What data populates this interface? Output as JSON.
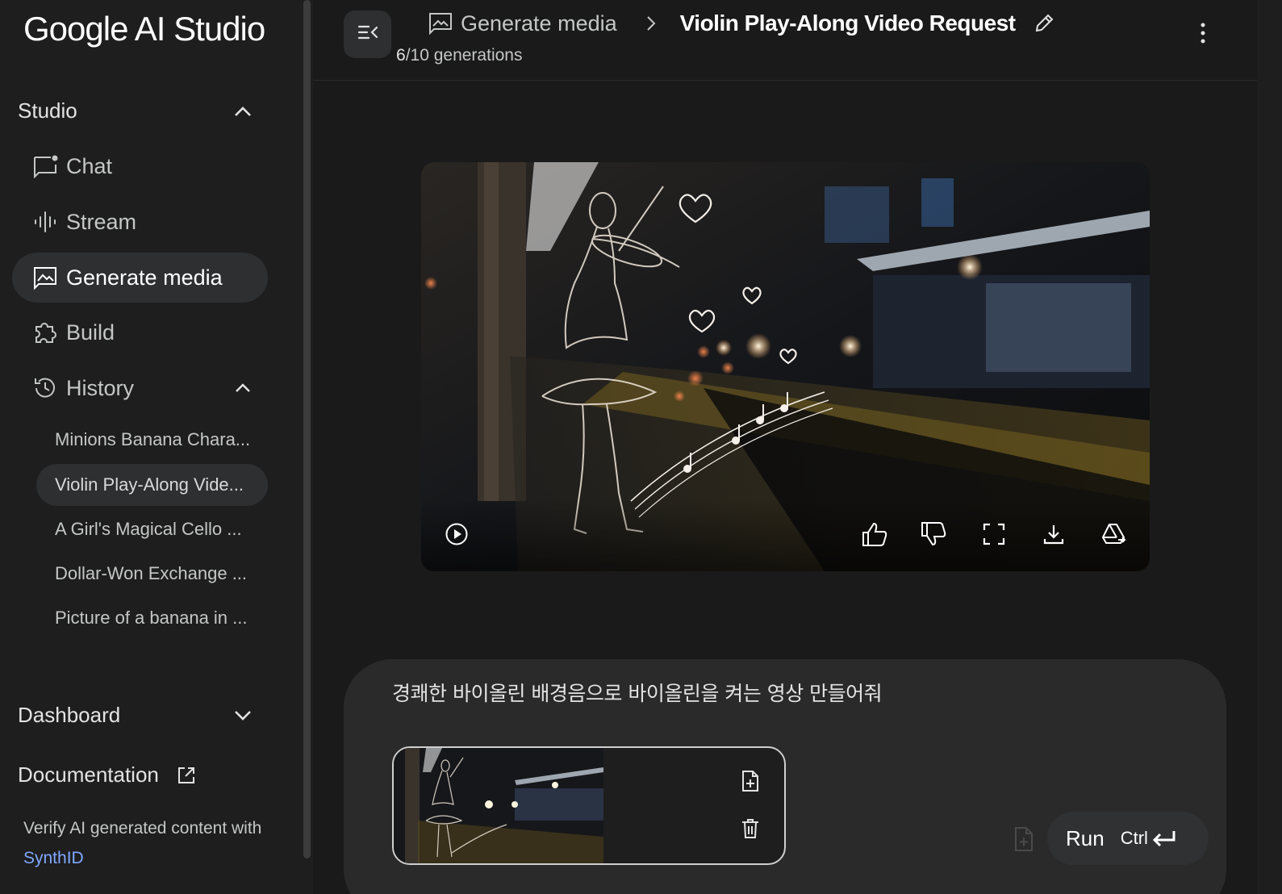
{
  "app": {
    "logo": "Google AI Studio"
  },
  "sidebar": {
    "studio_label": "Studio",
    "items": [
      {
        "label": "Chat",
        "icon": "chat-icon"
      },
      {
        "label": "Stream",
        "icon": "stream-icon"
      },
      {
        "label": "Generate media",
        "icon": "image-icon",
        "active": true
      },
      {
        "label": "Build",
        "icon": "build-icon"
      }
    ],
    "history_label": "History",
    "history": [
      {
        "label": "Minions Banana Chara..."
      },
      {
        "label": "Violin Play-Along Vide...",
        "active": true
      },
      {
        "label": "A Girl's Magical Cello ..."
      },
      {
        "label": "Dollar-Won Exchange ..."
      },
      {
        "label": "Picture of a banana in ..."
      }
    ],
    "dashboard_label": "Dashboard",
    "documentation_label": "Documentation",
    "verify_text": "Verify AI generated content with",
    "synthid_link": "SynthID"
  },
  "header": {
    "breadcrumb_parent": "Generate media",
    "title": "Violin Play-Along Video Request",
    "generations_used": "6",
    "generations_total": "/10 generations"
  },
  "prompt": {
    "text": "경쾌한 바이올린 배경음으로 바이올린을 켜는 영상 만들어줘",
    "run_label": "Run",
    "shortcut": "Ctrl"
  },
  "colors": {
    "background": "#1a1a1a",
    "sidebar": "#1e1e1e",
    "active_item": "#2d2f31",
    "prompt_box": "#2a2a2a",
    "link": "#7fa8ff"
  }
}
